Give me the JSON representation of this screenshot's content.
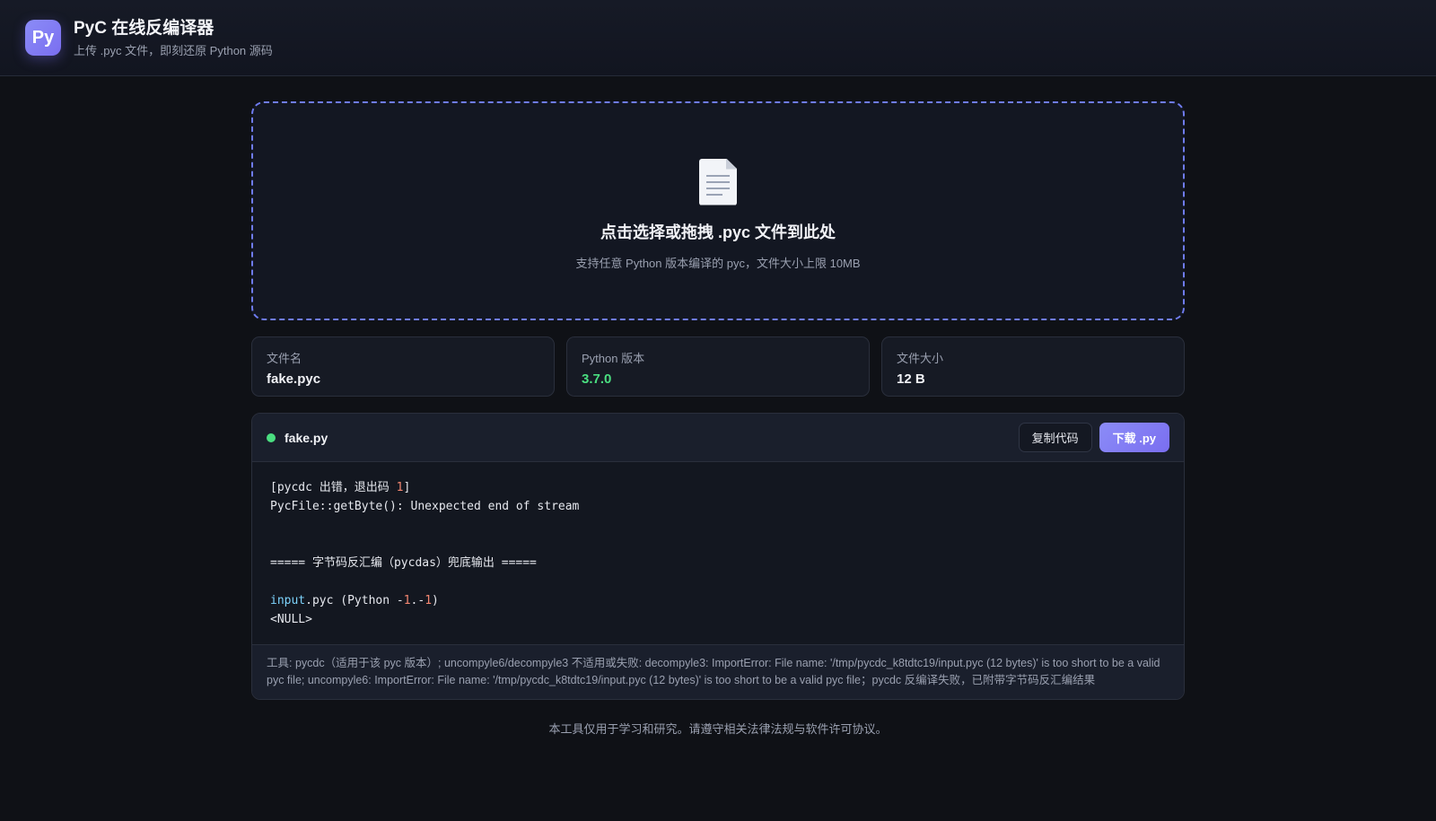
{
  "header": {
    "logo_text": "Py",
    "title": "PyC 在线反编译器",
    "subtitle": "上传 .pyc 文件，即刻还原 Python 源码"
  },
  "dropzone": {
    "icon": "document-icon",
    "title": "点击选择或拖拽 .pyc 文件到此处",
    "subtitle": "支持任意 Python 版本编译的 pyc，文件大小上限 10MB"
  },
  "info": {
    "filename_label": "文件名",
    "filename_value": "fake.pyc",
    "version_label": "Python 版本",
    "version_value": "3.7.0",
    "size_label": "文件大小",
    "size_value": "12 B"
  },
  "code": {
    "filename": "fake.py",
    "copy_label": "复制代码",
    "download_label": "下载 .py",
    "lines": {
      "l1_pre": "[pycdc 出错，退出码 ",
      "l1_num": "1",
      "l1_post": "]",
      "l2": "PycFile::getByte(): Unexpected end of stream",
      "l3": "===== 字节码反汇编（pycdas）兜底输出 =====",
      "l4_kw": "input",
      "l4_a": ".pyc (Python -",
      "l4_n1": "1",
      "l4_b": ".-",
      "l4_n2": "1",
      "l4_c": ")",
      "l5": "<NULL>"
    },
    "tool_note": "工具: pycdc（适用于该 pyc 版本）; uncompyle6/decompyle3 不适用或失败: decompyle3: ImportError: File name: '/tmp/pycdc_k8tdtc19/input.pyc (12 bytes)' is too short to be a valid pyc file; uncompyle6: ImportError: File name: '/tmp/pycdc_k8tdtc19/input.pyc (12 bytes)' is too short to be a valid pyc file；pycdc 反编译失败，已附带字节码反汇编结果"
  },
  "footer": "本工具仅用于学习和研究。请遵守相关法律法规与软件许可协议。",
  "colors": {
    "accent": "#7a6ef0",
    "success": "#4ade80",
    "dropzone_border": "#6f7cf0"
  }
}
